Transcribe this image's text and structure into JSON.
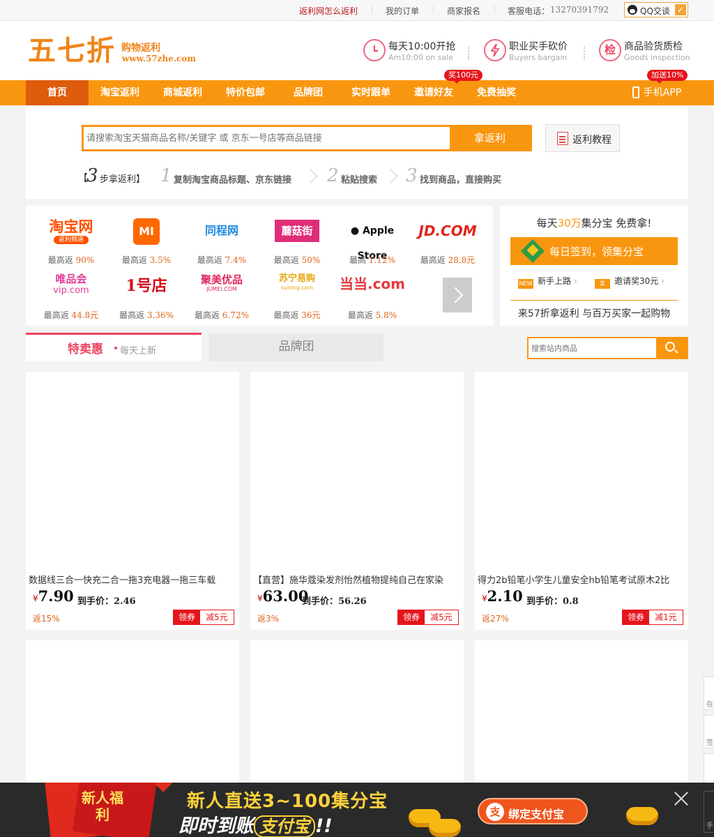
{
  "topbar": {
    "links": [
      "返利网怎么返利",
      "我的订单",
      "商家报名",
      "客服电话："
    ],
    "phone": "13270391792",
    "qq_label": "QQ交谈"
  },
  "header": {
    "logo": "五七折",
    "logo_sub": "购物返利",
    "logo_url": "www.57zhe.com",
    "features": [
      {
        "title": "每天10:00开抢",
        "sub": "Am10:00 on sale",
        "icon": "clock-icon"
      },
      {
        "title": "职业买手砍价",
        "sub": "Buyers bargain",
        "icon": "lightning-icon"
      },
      {
        "title": "商品验货质检",
        "sub": "Goods inspection",
        "icon": "inspect-icon",
        "glyph": "检"
      }
    ]
  },
  "nav": {
    "items": [
      "首页",
      "淘宝返利",
      "商城返利",
      "特价包邮",
      "品牌团",
      "实时跟单",
      "邀请好友",
      "免费抽奖"
    ],
    "badge_invite": "奖100元",
    "badge_app": "加送10%",
    "app_label": "手机APP"
  },
  "search": {
    "placeholder": "请搜索淘宝天猫商品名称/关键字 或 京东一号店等商品链接",
    "button": "拿返利",
    "tutorial": "返利教程",
    "steps": {
      "open": "【",
      "num": "3",
      "label": "步拿返利】",
      "s1_num": "1",
      "s1": "复制淘宝商品标题、京东链接",
      "s2_num": "2",
      "s2": "粘贴搜索",
      "s3_num": "3",
      "s3": "找到商品，直接购买"
    }
  },
  "stores": [
    {
      "name": "淘宝网",
      "sub": "返利频道",
      "prefix": "最高返",
      "value": "90%"
    },
    {
      "name": "MI",
      "prefix": "最高返",
      "value": "3.5%"
    },
    {
      "name": "同程网",
      "prefix": "最高返",
      "value": "7.4%"
    },
    {
      "name": "蘑菇街",
      "prefix": "最高返",
      "value": "50%"
    },
    {
      "name": " Apple Store",
      "prefix": "最高",
      "value": "1.12%"
    },
    {
      "name": "JD.COM",
      "prefix": "最高返",
      "value": "28.8元"
    },
    {
      "name": "唯品会",
      "sub": "vip.com",
      "prefix": "最高返",
      "value": "44.8元"
    },
    {
      "name": "1号店",
      "prefix": "最高返",
      "value": "3.36%"
    },
    {
      "name": "聚美优品",
      "sub": "JUMEI.COM",
      "prefix": "最高返",
      "value": "6.72%"
    },
    {
      "name": "苏宁易购",
      "sub": "suning.com",
      "prefix": "最高返",
      "value": "36元"
    },
    {
      "name": "当当.com",
      "prefix": "最高返",
      "value": "5.8%"
    }
  ],
  "promo": {
    "title_a": "每天",
    "title_num": "30万",
    "title_b": "集分宝 免费拿!",
    "sign": "每日签到，领集分宝",
    "link1_tag": "NEW",
    "link1": "新手上路",
    "link2_tag": "奖",
    "link2": "邀请奖30元",
    "footer": "来57折拿返利 与百万买家一起购物"
  },
  "tabs": {
    "tab1": "特卖惠",
    "tab1_sub": "每天上新",
    "tab2": "品牌团",
    "site_search_placeholder": "搜索站内商品"
  },
  "products": [
    {
      "title": "数据线三合一快充二合一拖3充电器一拖三车载",
      "price": "7.90",
      "hand_label": "到手价：",
      "hand": "2.46",
      "rebate": "返15%",
      "coupon": "领券",
      "discount": "减5元"
    },
    {
      "title": "【直营】施华蔻染发剂怡然植物提纯自己在家染",
      "price": "63.00",
      "hand_label": "到手价：",
      "hand": "56.26",
      "rebate": "返3%",
      "coupon": "领券",
      "discount": "减5元"
    },
    {
      "title": "得力2b铅笔小学生儿童安全hb铅笔考试原木2比",
      "price": "2.10",
      "hand_label": "到手价：",
      "hand": "0.8",
      "rebate": "返27%",
      "coupon": "领券",
      "discount": "减1元"
    }
  ],
  "currency": "¥",
  "side_tools": [
    "在",
    "签",
    "",
    "手"
  ],
  "banner": {
    "newbie": "新人福利",
    "line1": "新人直送3~100集分宝",
    "line2_a": "即时到账",
    "line2_b": "支付宝",
    "line2_c": "!!",
    "bind_icon": "支",
    "bind": "绑定支付宝"
  },
  "colors": {
    "accent": "#f9960f",
    "nav_active": "#de5c0b",
    "red": "#e5161c",
    "pink": "#ec4461"
  }
}
